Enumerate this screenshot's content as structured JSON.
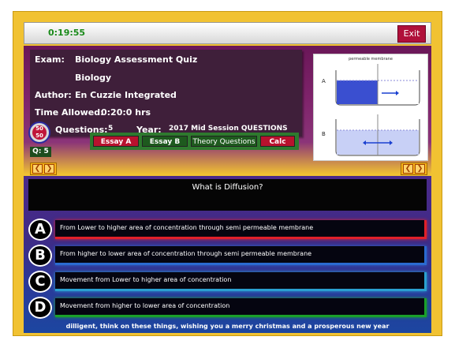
{
  "timer": "0:19:55",
  "exit_label": "Exit",
  "exam": {
    "exam_label": "Exam:",
    "exam_value": "Biology Assessment Quiz",
    "subject": "Biology",
    "author_label": "Author:",
    "author_value": "En Cuzzie Integrated",
    "time_label": "Time Allowed:",
    "time_value": "0:20:0 hrs",
    "questions_label": "Questions:",
    "questions_value": "5",
    "year_label": "Year:",
    "year_value": "2017 Mid Session QUESTIONS"
  },
  "badge": {
    "top": "50",
    "bottom": "50"
  },
  "question_counter": "Q: 5",
  "buttons": {
    "essay_a": "Essay A",
    "essay_b": "Essay B",
    "theory": "Theory Questions",
    "calc": "Calc"
  },
  "diagram": {
    "caption": "permeable membrane",
    "label_a": "A",
    "label_b": "B"
  },
  "question": "What is Diffusion?",
  "options": [
    {
      "letter": "A",
      "text": "From Lower to higher area of concentration through semi permeable membrane",
      "accent": "#e0202a"
    },
    {
      "letter": "B",
      "text": "From higher to lower area of concentration through semi permeable membrane",
      "accent": "#2a6ad0"
    },
    {
      "letter": "C",
      "text": "Movement from Lower to higher area of concentration",
      "accent": "#2aa0d0"
    },
    {
      "letter": "D",
      "text": "Movement from higher to lower area of concentration",
      "accent": "#1aa02a"
    }
  ],
  "footer": "dilligent, think on these things, wishing you a merry christmas and a prosperous new year"
}
